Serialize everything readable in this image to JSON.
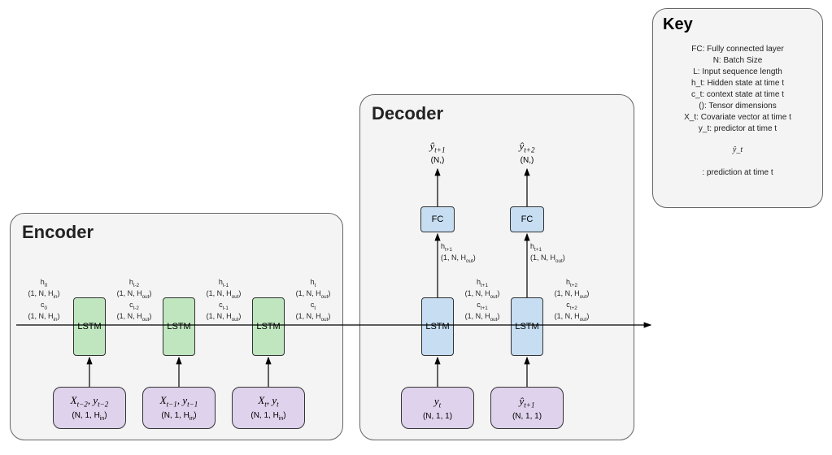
{
  "panels": {
    "encoder_title": "Encoder",
    "decoder_title": "Decoder",
    "key_title": "Key"
  },
  "blocks": {
    "lstm_label": "LSTM",
    "fc_label": "FC"
  },
  "inputs": {
    "enc1_math": "X_{t−2}, y_{t−2}",
    "enc1_dim": "(N, 1, H_in)",
    "enc2_math": "X_{t−1}, y_{t−1}",
    "enc2_dim": "(N, 1, H_in)",
    "enc3_math": "X_t, y_t",
    "enc3_dim": "(N, 1, H_in)",
    "dec1_math": "y_t",
    "dec1_dim": "(N, 1, 1)",
    "dec2_math": "ŷ_{t+1}",
    "dec2_dim": "(N, 1, 1)"
  },
  "states": {
    "h0": "h₀\n(1, N, H_in)\nc₀\n(1, N, H_in)",
    "ht2": "h_{t-2}\n(1, N, H_out)\nc_{t-2}\n(1, N, H_out)",
    "ht1": "h_{t-1}\n(1, N, H_out)\nc_{t-1}\n(1, N, H_out)",
    "ht": "h_t\n(1, N, H_out)\nc_t\n(1, N, H_out)",
    "htp1": "h_{t+1}\n(1, N, H_out)\nc_{t+1}\n(1, N, H_out)",
    "htp2": "h_{t+2}\n(1, N, H_out)\nc_{t+2}\n(1, N, H_out)",
    "fc1": "h_{t+1}\n(1, N, H_out)",
    "fc2": "h_{t+1}\n(1, N, H_out)"
  },
  "outputs": {
    "y1_math": "ŷ_{t+1}",
    "y1_dim": "(N,)",
    "y2_math": "ŷ_{t+2}",
    "y2_dim": "(N,)"
  },
  "key_items": [
    "FC: Fully connected layer",
    "N: Batch Size",
    "L: Input sequence length",
    "h_t: Hidden state at time t",
    "c_t: context state at time t",
    "(): Tensor dimensions",
    "X_t: Covariate vector at time t",
    "y_t: predictor at time t",
    "ŷ_t",
    ": prediction at time t"
  ]
}
